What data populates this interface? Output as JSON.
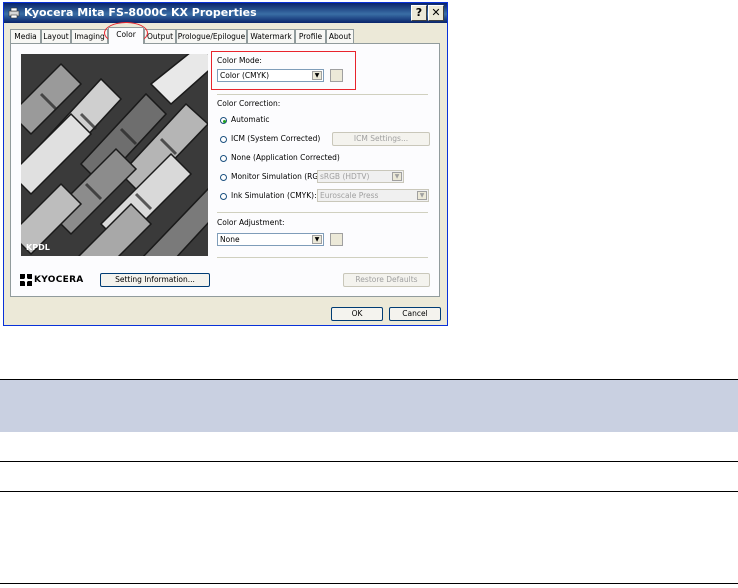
{
  "window": {
    "title": "Kyocera Mita FS-8000C KX Properties",
    "help_label": "?",
    "close_label": "✕"
  },
  "tabs": [
    {
      "label": "Media"
    },
    {
      "label": "Layout"
    },
    {
      "label": "Imaging"
    },
    {
      "label": "Color"
    },
    {
      "label": "Output"
    },
    {
      "label": "Prologue/Epilogue"
    },
    {
      "label": "Watermark"
    },
    {
      "label": "Profile"
    },
    {
      "label": "About"
    }
  ],
  "preview": {
    "caption": "KPDL"
  },
  "color_mode": {
    "label": "Color Mode:",
    "value": "Color (CMYK)"
  },
  "color_correction": {
    "label": "Color Correction:",
    "automatic": "Automatic",
    "icm": "ICM (System Corrected)",
    "icm_settings": "ICM Settings...",
    "none": "None (Application Corrected)",
    "monitor": "Monitor Simulation (RGB):",
    "monitor_value": "sRGB (HDTV)",
    "ink": "Ink Simulation (CMYK):",
    "ink_value": "Euroscale Press"
  },
  "color_adjustment": {
    "label": "Color Adjustment:",
    "value": "None"
  },
  "brand": {
    "name": "KYOCERA"
  },
  "buttons": {
    "setting_info": "Setting Information...",
    "restore": "Restore Defaults",
    "ok": "OK",
    "cancel": "Cancel"
  },
  "colors": {
    "title_bar": "#0a246a",
    "highlight": "#e8242c",
    "table_header": "#c9d0e1"
  }
}
